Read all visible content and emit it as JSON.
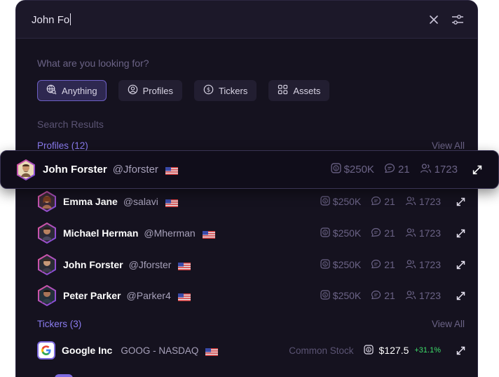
{
  "search": {
    "value": "John Fo"
  },
  "prompt": "What are you looking for?",
  "filters": [
    {
      "label": "Anything",
      "icon": "globe-search-icon",
      "active": true
    },
    {
      "label": "Profiles",
      "icon": "user-circle-icon",
      "active": false
    },
    {
      "label": "Tickers",
      "icon": "dollar-circle-icon",
      "active": false
    },
    {
      "label": "Assets",
      "icon": "grid-icon",
      "active": false
    }
  ],
  "results_label": "Search Results",
  "profiles": {
    "title": "Profiles (12)",
    "view_all": "View All",
    "items": [
      {
        "name": "John Forster",
        "handle": "@Jforster",
        "value": "$250K",
        "comments": "21",
        "followers": "1723",
        "highlighted": true
      },
      {
        "name": "Emma Jane",
        "handle": "@salavi",
        "value": "$250K",
        "comments": "21",
        "followers": "1723"
      },
      {
        "name": "Michael Herman",
        "handle": "@Mherman",
        "value": "$250K",
        "comments": "21",
        "followers": "1723"
      },
      {
        "name": "John Forster",
        "handle": "@Jforster",
        "value": "$250K",
        "comments": "21",
        "followers": "1723"
      },
      {
        "name": "Peter Parker",
        "handle": "@Parker4",
        "value": "$250K",
        "comments": "21",
        "followers": "1723"
      }
    ]
  },
  "tickers": {
    "title": "Tickers (3)",
    "view_all": "View All",
    "items": [
      {
        "name": "Google Inc",
        "symbol": "GOOG - NASDAQ",
        "type": "Common Stock",
        "price": "$127.5",
        "change": "+31.1%"
      }
    ]
  },
  "colors": {
    "accent": "#8b7cf0",
    "panel": "#15121f",
    "positive": "#3ddc6a"
  }
}
